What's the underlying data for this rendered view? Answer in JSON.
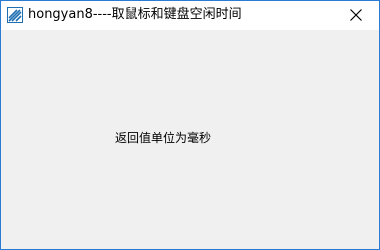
{
  "window": {
    "title": "hongyan8----取鼠标和键盘空闲时间",
    "app_icon": "app-icon",
    "close_icon": "close-icon",
    "border_color": "#2b7bd3",
    "background_color": "#f0f0f0"
  },
  "content": {
    "label_text": "返回值单位为毫秒"
  }
}
